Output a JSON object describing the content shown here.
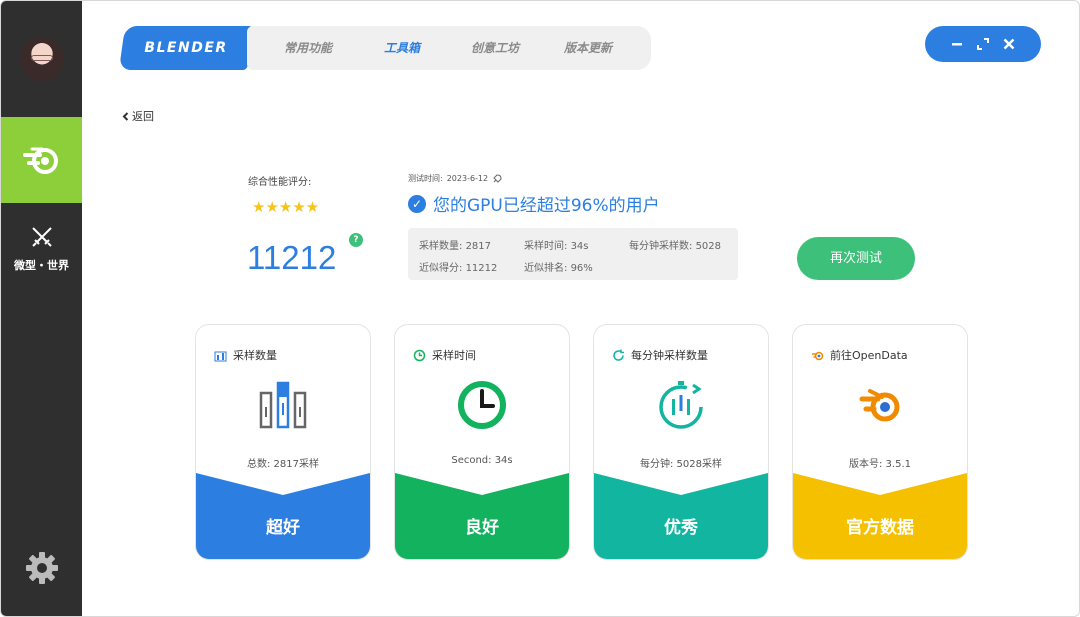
{
  "sidebar": {
    "world_label": "微型・世界"
  },
  "header": {
    "brand": "BLENDER",
    "tabs": [
      {
        "label": "常用功能"
      },
      {
        "label": "工具箱"
      },
      {
        "label": "创意工坊"
      },
      {
        "label": "版本更新"
      }
    ],
    "active_tab": "工具箱",
    "window_controls": [
      "minimize",
      "maximize",
      "close"
    ]
  },
  "back_label": "返回",
  "score": {
    "label": "综合性能评分:",
    "stars": "★★★★★",
    "value": "11212"
  },
  "test": {
    "time_label": "测试时间:",
    "time_value": "2023-6-12",
    "headline": "您的GPU已经超过96%的用户",
    "stats": [
      {
        "label": "采样数量:",
        "value": "2817"
      },
      {
        "label": "采样时间:",
        "value": "34s"
      },
      {
        "label": "每分钟采样数:",
        "value": "5028"
      },
      {
        "label": "近似得分:",
        "value": "11212"
      },
      {
        "label": "近似排名:",
        "value": "96%"
      }
    ],
    "retest_label": "再次测试"
  },
  "cards": [
    {
      "title": "采样数量",
      "info": "总数: 2817采样",
      "band_label": "超好",
      "color": "#2c7ee0",
      "icon": "bar-chart-icon"
    },
    {
      "title": "采样时间",
      "info": "Second: 34s",
      "band_label": "良好",
      "color": "#12b25e",
      "icon": "clock-icon"
    },
    {
      "title": "每分钟采样数量",
      "info": "每分钟: 5028采样",
      "band_label": "优秀",
      "color": "#12b5a0",
      "icon": "refresh-timer-icon"
    },
    {
      "title": "前往OpenData",
      "info": "版本号: 3.5.1",
      "band_label": "官方数据",
      "color": "#f5c000",
      "icon": "blender-logo-icon"
    }
  ]
}
